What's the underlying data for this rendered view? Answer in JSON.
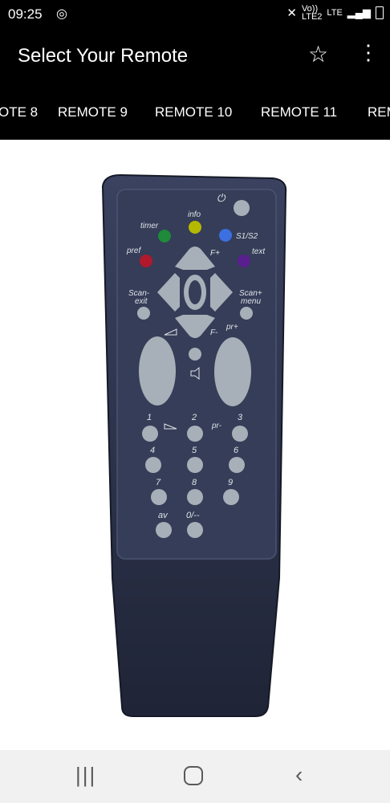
{
  "status": {
    "time": "09:25",
    "volte": "Vo))",
    "lte": "LTE",
    "lte2": "LTE2"
  },
  "appbar": {
    "title": "Select Your Remote"
  },
  "tabs": [
    "OTE 8",
    "REMOTE 9",
    "REMOTE 10",
    "REMOTE 11",
    "REM"
  ],
  "remote": {
    "labels": {
      "power": "⏻",
      "timer": "timer",
      "info": "info",
      "s1s2": "S1/S2",
      "pref": "pref",
      "text": "text",
      "f_plus": "F+",
      "f_minus": "F-",
      "scan_exit": [
        "Scan-",
        "exit"
      ],
      "scan_menu": [
        "Scan+",
        "menu"
      ],
      "pr_plus": "pr+",
      "pr_minus": "pr-",
      "av": "av",
      "zero": "0/--",
      "digits": [
        "1",
        "2",
        "3",
        "4",
        "5",
        "6",
        "7",
        "8",
        "9"
      ]
    },
    "colors": {
      "body": "#2f3650",
      "button": "#a7b0b8",
      "green": "#1e8a3a",
      "yellow": "#b5b800",
      "blue": "#3c6fe0",
      "red": "#b0182c",
      "purple": "#5a1f8f"
    }
  },
  "icons": {
    "star": "star-icon",
    "more": "more-vert-icon",
    "recents": "recents-icon",
    "home": "home-icon",
    "back": "back-icon"
  }
}
